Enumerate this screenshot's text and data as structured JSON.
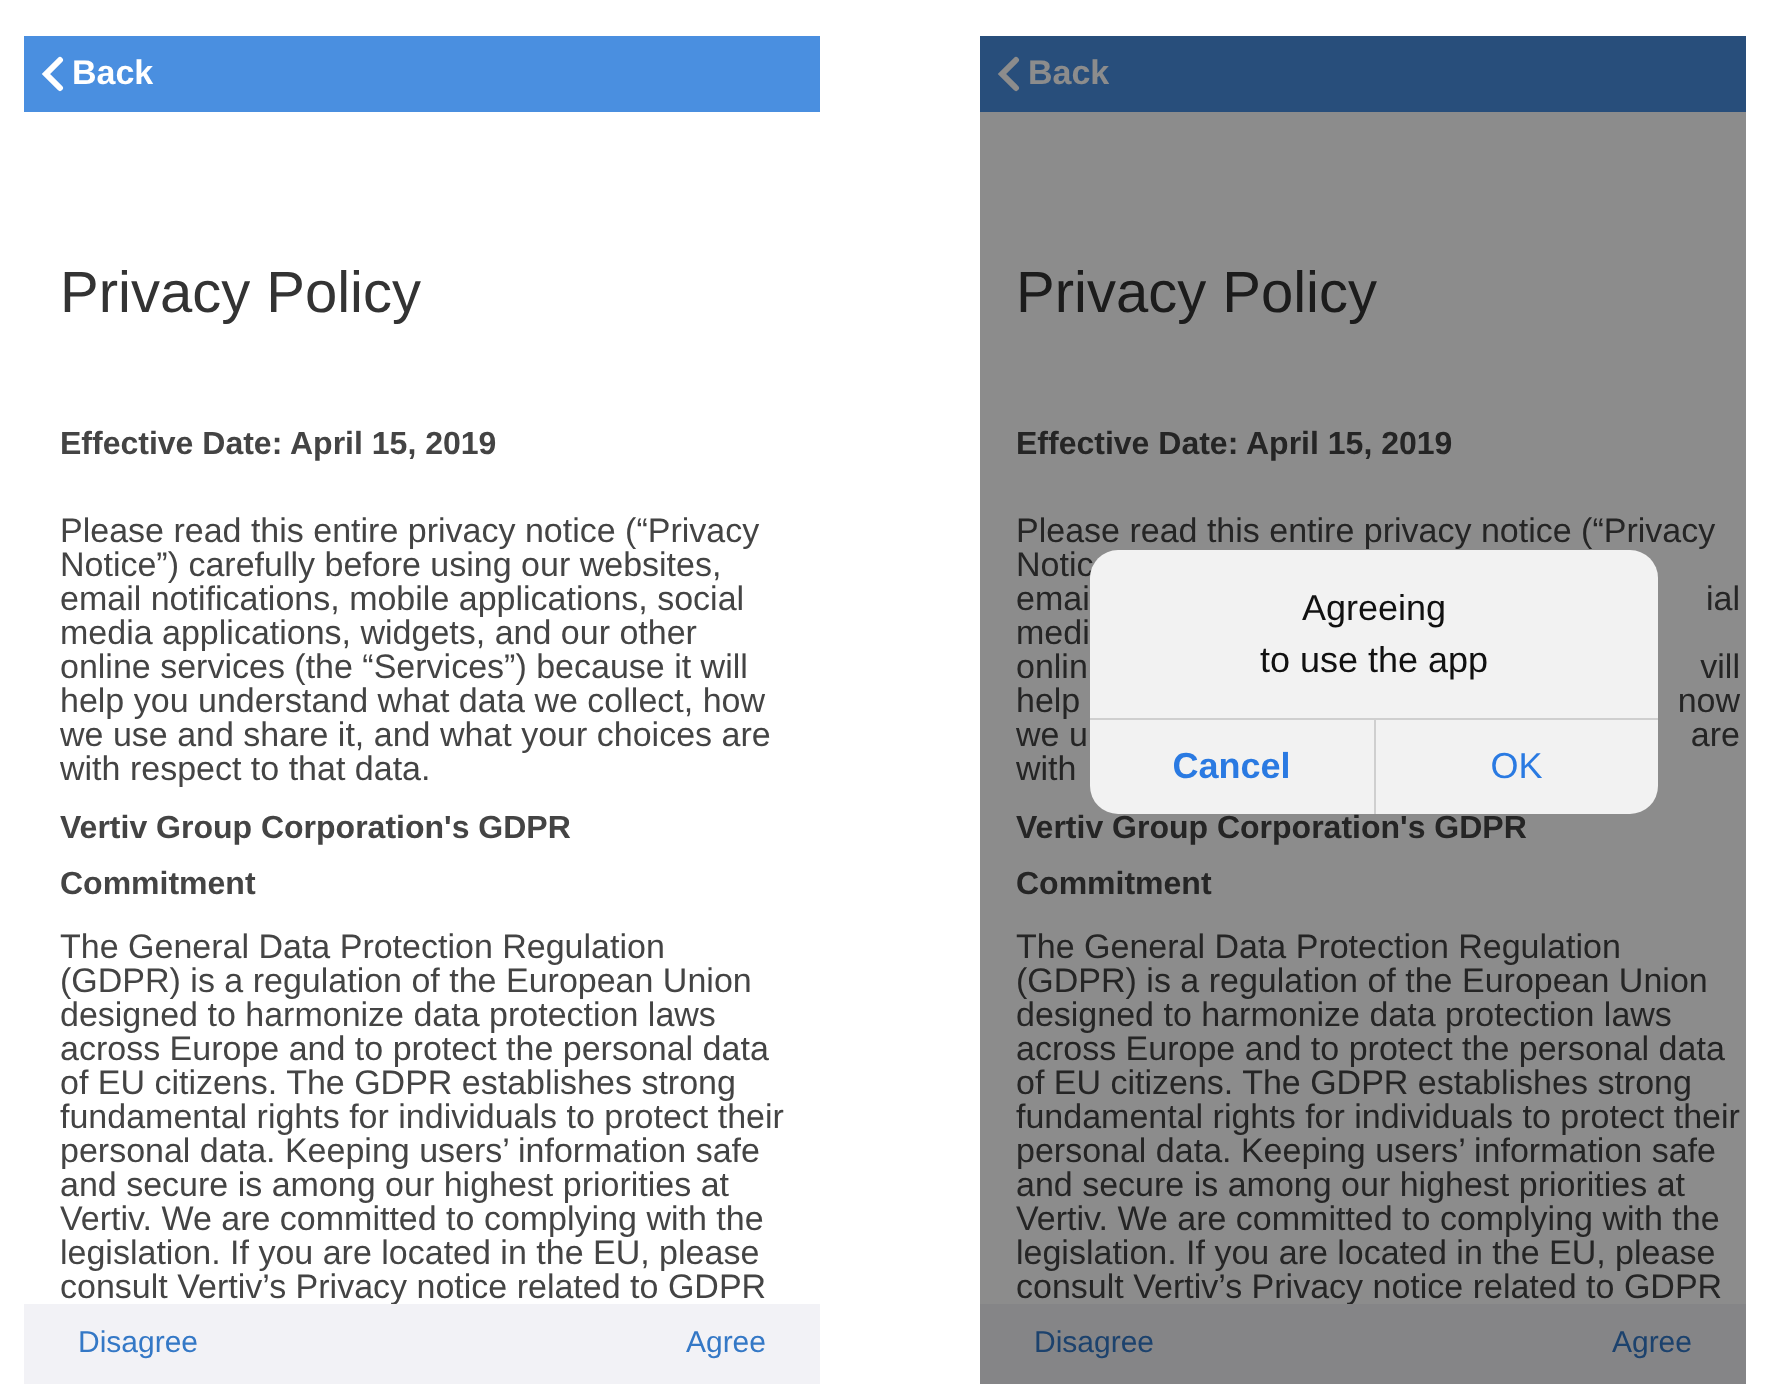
{
  "screens": [
    {
      "back_label": "Back",
      "title": "Privacy Policy",
      "effective_date": "Effective Date:  April 15, 2019",
      "intro": "Please read this entire privacy notice (“Privacy Notice”) carefully before using our websites, email notifications, mobile applications, social media applications, widgets, and our other online services (the “Services”) because it will help you understand what data we collect, how we use and share it, and what your choices are with respect to that data.",
      "section_heading_lines": [
        "Vertiv Group Corporation's GDPR",
        "Commitment"
      ],
      "gdpr_text": "The General Data Protection Regulation (GDPR) is a regulation of the European Union designed to harmonize data protection laws across Europe and to protect the personal data of EU citizens. The GDPR establishes strong fundamental rights for individuals to protect their personal data. Keeping users’ information safe and secure is among our highest priorities at Vertiv. We are committed to complying with the legislation. If you are located in the EU, please consult Vertiv’s Privacy notice related to GDPR",
      "footer": {
        "left": "Disagree",
        "right": "Agree"
      },
      "dimmed": false
    },
    {
      "back_label": "Back",
      "title": "Privacy Policy",
      "effective_date": "Effective Date:  April 15, 2019",
      "intro_first_line": "Please read this entire privacy notice (“Privacy",
      "intro_fragments": [
        {
          "left": "Notic"
        },
        {
          "left": "emai",
          "right": "ial"
        },
        {
          "left": "medi"
        },
        {
          "left": "onlin",
          "right": "vill"
        },
        {
          "left": "help",
          "right": "now"
        },
        {
          "left": "we u",
          "right": "are"
        },
        {
          "left": "with"
        }
      ],
      "dialog": {
        "title_lines": [
          "Agreeing",
          "to use the app"
        ],
        "buttons": [
          "Cancel",
          "OK"
        ]
      },
      "section_heading_lines": [
        "Vertiv Group Corporation's GDPR",
        "Commitment"
      ],
      "gdpr_text": "The General Data Protection Regulation (GDPR) is a regulation of the European Union designed to harmonize data protection laws across Europe and to protect the personal data of EU citizens. The GDPR establishes strong fundamental rights for individuals to protect their personal data. Keeping users’ information safe and secure is among our highest priorities at Vertiv. We are committed to complying with the legislation. If you are located in the EU, please consult Vertiv’s Privacy notice related to GDPR",
      "footer": {
        "left": "Disagree",
        "right": "Agree"
      },
      "dimmed": true
    }
  ]
}
